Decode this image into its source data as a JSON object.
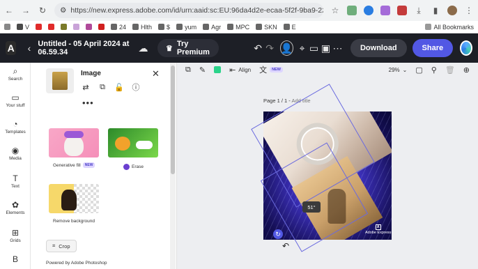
{
  "browser": {
    "url": "https://new.express.adobe.com/id/urn:aaid:sc:EU:96da4d2e-ecaa-5f2f-9ba9-220780267599...",
    "bookmarks": [
      "V",
      "24",
      "Hlth",
      "$",
      "yum",
      "Agr",
      "MPC",
      "SKN",
      "E"
    ],
    "all_bookmarks": "All Bookmarks"
  },
  "header": {
    "logo": "A",
    "doc_title": "Untitled - 05 April 2024 at 06.59.34",
    "try_premium": "Try Premium",
    "download": "Download",
    "share": "Share"
  },
  "rail": {
    "items": [
      "Search",
      "Your stuff",
      "Templates",
      "Media",
      "Text",
      "Elements",
      "Grids"
    ]
  },
  "panel": {
    "title": "Image",
    "cards": [
      {
        "label": "Generative fill",
        "badge": "NEW"
      },
      {
        "label": "Erase"
      },
      {
        "label": "Remove background"
      }
    ],
    "crop": "Crop",
    "powered": "Powered by Adobe Photoshop"
  },
  "toolbar": {
    "align": "Align",
    "new_badge": "NEW",
    "zoom": "29%"
  },
  "canvas": {
    "page_label": "Page 1 / 1 - ",
    "add_title": "Add title",
    "angle": "51°",
    "watermark": "Adobe Express"
  }
}
